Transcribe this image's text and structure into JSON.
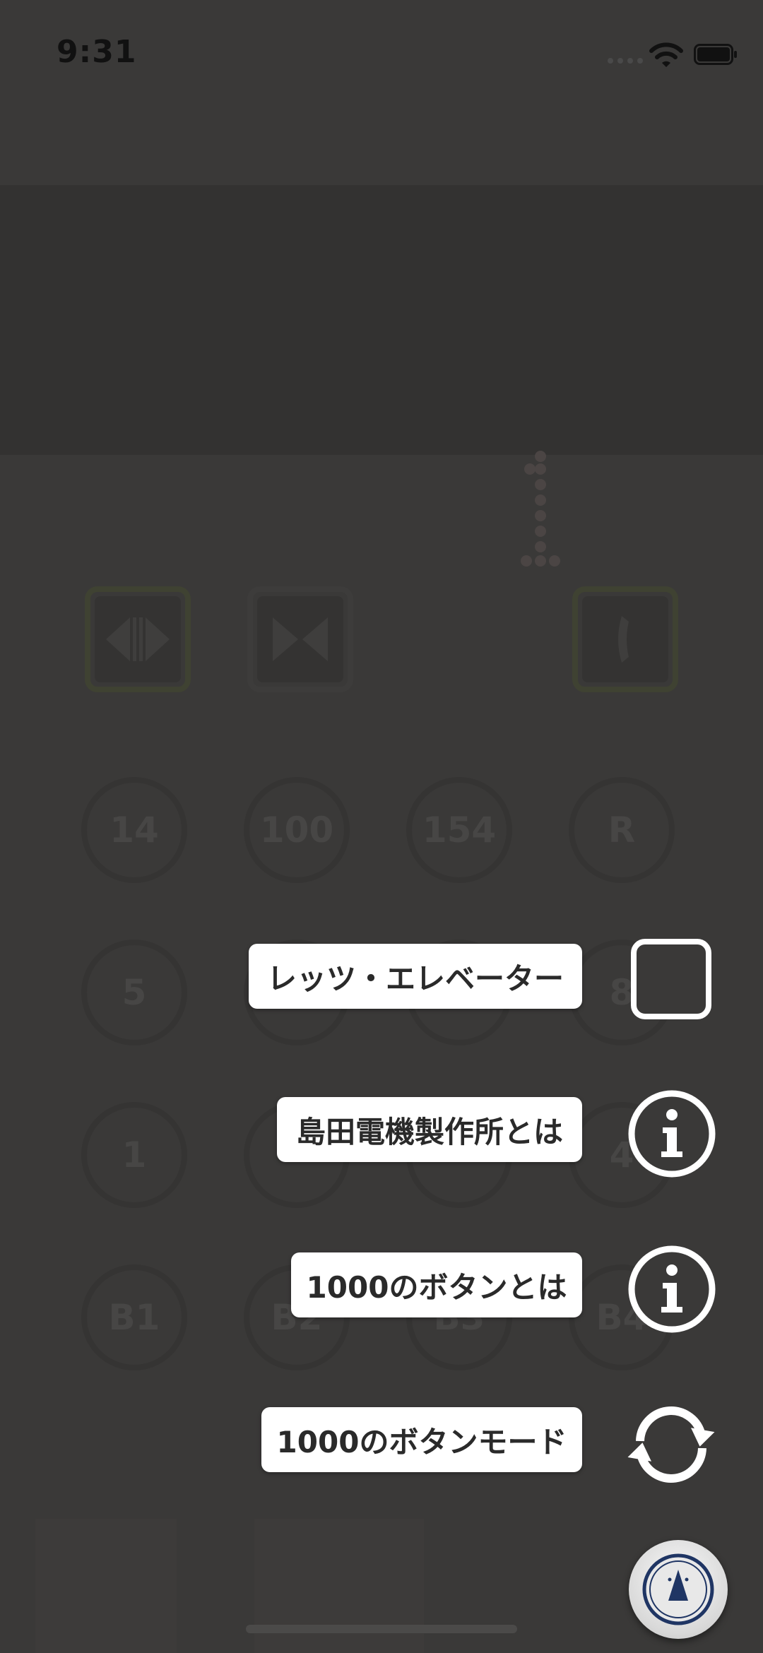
{
  "status_bar": {
    "time": "9:31"
  },
  "display": {
    "floor": "1"
  },
  "control_buttons": [
    {
      "name": "door-open-button",
      "icon": "door-open-icon",
      "accent": "#6f7a3a"
    },
    {
      "name": "door-close-button",
      "icon": "door-close-icon",
      "accent": "#4a4948"
    },
    {
      "name": "emergency-call-button",
      "icon": "phone-icon",
      "accent": "#6f7a3a"
    }
  ],
  "floor_buttons": [
    [
      "14",
      "100",
      "154",
      "R"
    ],
    [
      "5",
      "",
      "",
      "8"
    ],
    [
      "1",
      "",
      "",
      "4"
    ],
    [
      "B1",
      "B2",
      "B3",
      "B4"
    ]
  ],
  "menu": {
    "items": [
      {
        "label": "レッツ・エレベーター",
        "icon": "stop-square-icon"
      },
      {
        "label": "島田電機製作所とは",
        "icon": "info-icon"
      },
      {
        "label": "1000のボタンとは",
        "icon": "info-icon"
      },
      {
        "label": "1000のボタンモード",
        "icon": "refresh-icon"
      }
    ],
    "main_button_icon": "elevator-up-icon"
  },
  "colors": {
    "overlay_bg": "#3a3938",
    "label_bg": "#ffffff",
    "fab_navy": "#1f3564"
  }
}
